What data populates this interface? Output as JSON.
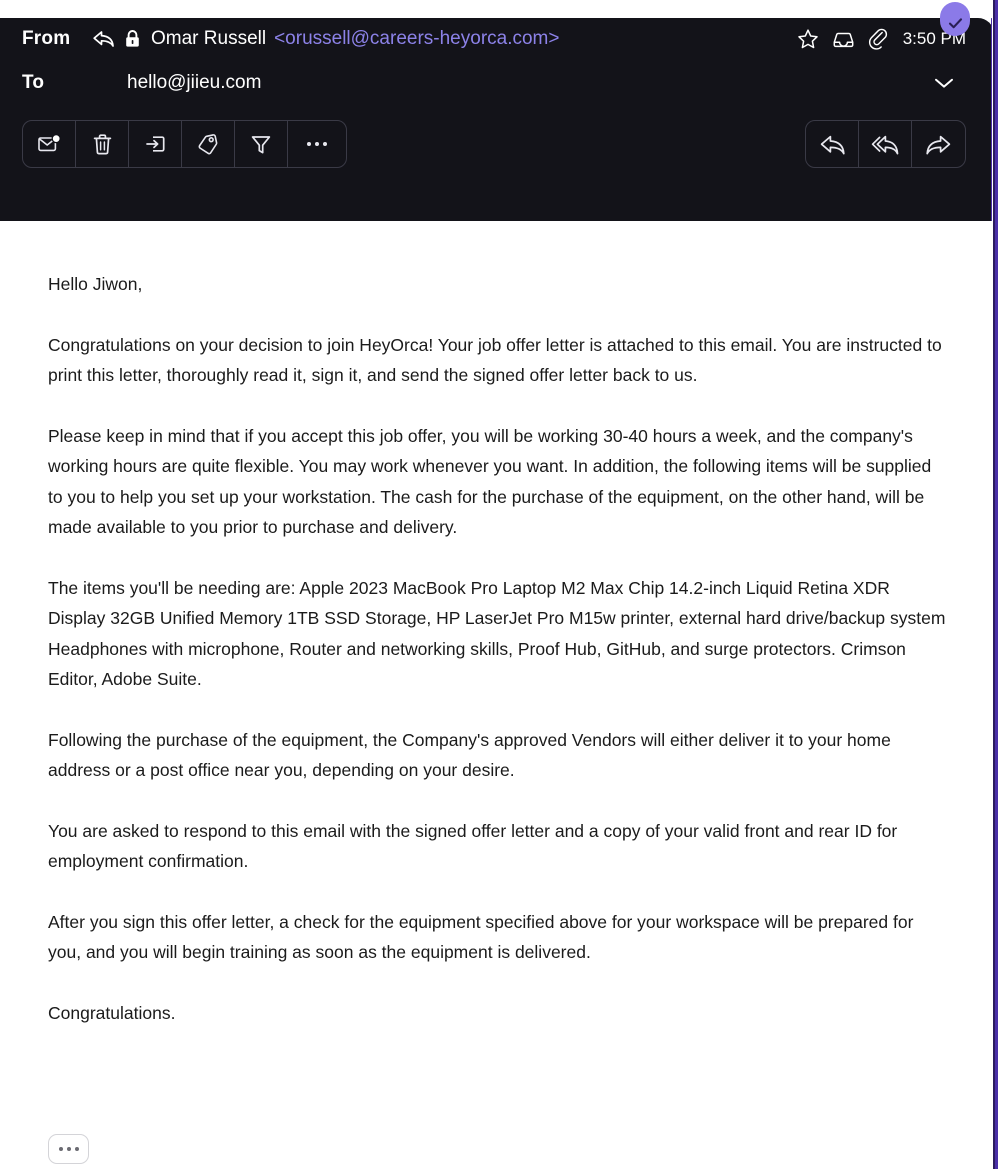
{
  "window": {
    "accent_color": "#4a2fa8",
    "header_bg": "#131319",
    "body_bg": "#ffffff",
    "link_color": "#8c82e8"
  },
  "badge": {
    "name": "selected-check-badge",
    "icon": "check-icon",
    "color": "#8b7ae8"
  },
  "header": {
    "from": {
      "label": "From",
      "reply_icon": "reply-arrow-icon",
      "lock_icon": "lock-icon",
      "sender_name": "Omar Russell",
      "sender_email": "<orussell@careers-heyorca.com>"
    },
    "to": {
      "label": "To",
      "address": "hello@jiieu.com",
      "expand_icon": "chevron-down-icon"
    },
    "meta": {
      "star_icon": "star-icon",
      "archive_icon": "inbox-archive-icon",
      "attachment_icon": "paperclip-icon",
      "time": "3:50 PM"
    }
  },
  "toolbar": {
    "left_actions": [
      {
        "name": "mark-unread-button",
        "icon": "envelope-unread-icon",
        "label": "Mark as unread"
      },
      {
        "name": "delete-button",
        "icon": "trash-icon",
        "label": "Delete"
      },
      {
        "name": "move-to-folder-button",
        "icon": "move-to-folder-icon",
        "label": "Move to folder"
      },
      {
        "name": "tag-button",
        "icon": "tag-icon",
        "label": "Tag"
      },
      {
        "name": "filter-button",
        "icon": "funnel-filter-icon",
        "label": "Filter"
      },
      {
        "name": "more-actions-button",
        "icon": "ellipsis-icon",
        "label": "More"
      }
    ],
    "right_actions": [
      {
        "name": "reply-button",
        "icon": "reply-icon",
        "label": "Reply"
      },
      {
        "name": "reply-all-button",
        "icon": "reply-all-icon",
        "label": "Reply all"
      },
      {
        "name": "forward-button",
        "icon": "forward-icon",
        "label": "Forward"
      }
    ]
  },
  "message": {
    "paragraphs": [
      "Hello Jiwon,",
      "Congratulations on your decision to join HeyOrca! Your job offer letter is attached to this email. You are instructed to print this letter, thoroughly read it, sign it, and send the signed offer letter back to us.",
      "Please keep in mind that if you accept this job offer, you will be working 30-40 hours a week, and the company's working hours are quite flexible. You may work whenever you want. In addition, the following items will be supplied to you to help you set up your workstation. The cash for the purchase of the equipment, on the other hand, will be made available to you prior to purchase and delivery.",
      "The items you'll be needing are: Apple 2023 MacBook Pro Laptop M2 Max Chip 14.2-inch Liquid Retina XDR Display 32GB Unified Memory 1TB SSD Storage, HP LaserJet Pro M15w printer, external hard drive/backup system Headphones with microphone, Router and networking skills, Proof Hub, GitHub, and surge protectors. Crimson Editor, Adobe Suite.",
      "Following the purchase of the equipment, the Company's approved Vendors will either deliver it to your home address or a post office near you, depending on your desire.",
      "You are asked to respond to this email with the signed offer letter and a copy of your valid front and rear ID for employment confirmation.",
      "After you sign this offer letter, a check for the equipment specified above for your workspace will be prepared for you, and you will begin training as soon as the equipment is delivered.",
      "Congratulations."
    ],
    "trimmed_content_button": {
      "name": "show-trimmed-content-button",
      "icon": "ellipsis-icon"
    }
  }
}
